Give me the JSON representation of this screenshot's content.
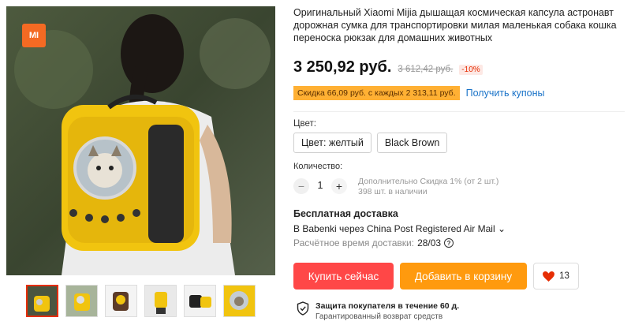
{
  "gallery": {
    "logo_text": "MI",
    "thumb_count": 6,
    "active_thumb": 0
  },
  "product": {
    "title": "Оригинальный Xiaomi Mijia дышащая космическая капсула астронавт дорожная сумка для транспортировки милая маленькая собака кошка переноска рюкзак для домашних животных",
    "price": "3 250,92 руб.",
    "old_price": "3 612,42 руб.",
    "discount": "-10%"
  },
  "coupon": {
    "badge": "Скидка 66,09 руб. с каждых 2 313,11 руб.",
    "link": "Получить купоны"
  },
  "color": {
    "label": "Цвет:",
    "options": [
      {
        "label": "Цвет: желтый"
      },
      {
        "label": "Black Brown"
      }
    ]
  },
  "quantity": {
    "label": "Количество:",
    "minus": "−",
    "plus": "+",
    "value": "1",
    "extra_discount": "Дополнительно Скидка 1% (от 2 шт.)",
    "stock": "398 шт. в наличии"
  },
  "shipping": {
    "title": "Бесплатная доставка",
    "to": "В Babenki через China Post Registered Air Mail ⌄",
    "time_label": "Расчётное время доставки:",
    "time_value": "28/03",
    "help_icon": "?"
  },
  "actions": {
    "buy": "Купить сейчас",
    "cart": "Добавить в корзину",
    "wish_count": "13"
  },
  "protection": {
    "title": "Защита покупателя в течение 60 д.",
    "subtitle": "Гарантированный возврат средств"
  },
  "colors": {
    "buy_button": "#ff4747",
    "cart_button": "#ff9a0e",
    "link": "#1a73c8",
    "coupon": "#ffb033",
    "heart": "#e62e04"
  }
}
